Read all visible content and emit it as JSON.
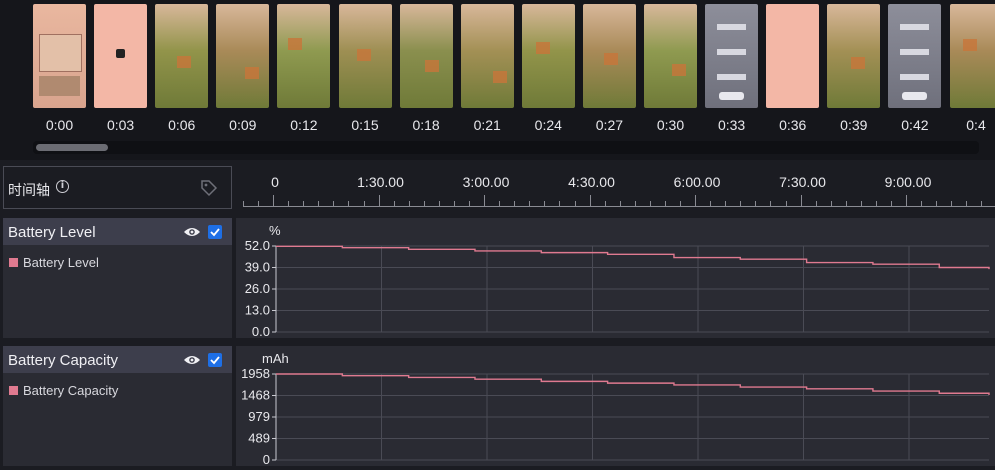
{
  "filmstrip": {
    "times": [
      "0:00",
      "0:03",
      "0:06",
      "0:09",
      "0:12",
      "0:15",
      "0:18",
      "0:21",
      "0:24",
      "0:27",
      "0:30",
      "0:33",
      "0:36",
      "0:39",
      "0:42",
      "0:4"
    ],
    "frame_kinds": [
      "menu",
      "blank",
      "game",
      "game",
      "game",
      "game",
      "game",
      "game",
      "game",
      "game",
      "game",
      "ui",
      "blank",
      "game",
      "ui",
      "game"
    ]
  },
  "timeline": {
    "title": "时间轴",
    "ruler_labels": [
      "0",
      "1:30.00",
      "3:00.00",
      "4:30.00",
      "6:00.00",
      "7:30.00",
      "9:00.00",
      "1("
    ]
  },
  "metrics": [
    {
      "name": "Battery Level",
      "legend": "Battery Level",
      "unit": "%",
      "color": "#e07a90",
      "visible": true,
      "checked": true,
      "yticks": [
        "52.0",
        "39.0",
        "26.0",
        "13.0",
        "0.0"
      ]
    },
    {
      "name": "Battery Capacity",
      "legend": "Battery Capacity",
      "unit": "mAh",
      "color": "#e07a90",
      "visible": true,
      "checked": true,
      "yticks": [
        "1958",
        "1468",
        "979",
        "489",
        "0"
      ]
    }
  ],
  "chart_data": [
    {
      "type": "line",
      "title": "Battery Level",
      "ylabel": "%",
      "ylim": [
        0,
        52
      ],
      "grid": true,
      "x": [
        "0:00",
        "1:00",
        "2:00",
        "3:00",
        "4:00",
        "5:00",
        "6:00",
        "7:00",
        "8:00",
        "9:00",
        "10:00",
        "10:45"
      ],
      "series": [
        {
          "name": "Battery Level",
          "values": [
            51.8,
            51,
            50,
            49,
            48,
            47,
            45,
            44,
            42,
            41,
            39,
            38
          ]
        }
      ]
    },
    {
      "type": "line",
      "title": "Battery Capacity",
      "ylabel": "mAh",
      "ylim": [
        0,
        1958
      ],
      "grid": true,
      "x": [
        "0:00",
        "1:00",
        "2:00",
        "3:00",
        "4:00",
        "5:00",
        "6:00",
        "7:00",
        "8:00",
        "9:00",
        "10:00",
        "10:45"
      ],
      "series": [
        {
          "name": "Battery Capacity",
          "values": [
            1958,
            1920,
            1880,
            1840,
            1790,
            1750,
            1710,
            1660,
            1620,
            1570,
            1520,
            1480
          ]
        }
      ]
    }
  ]
}
